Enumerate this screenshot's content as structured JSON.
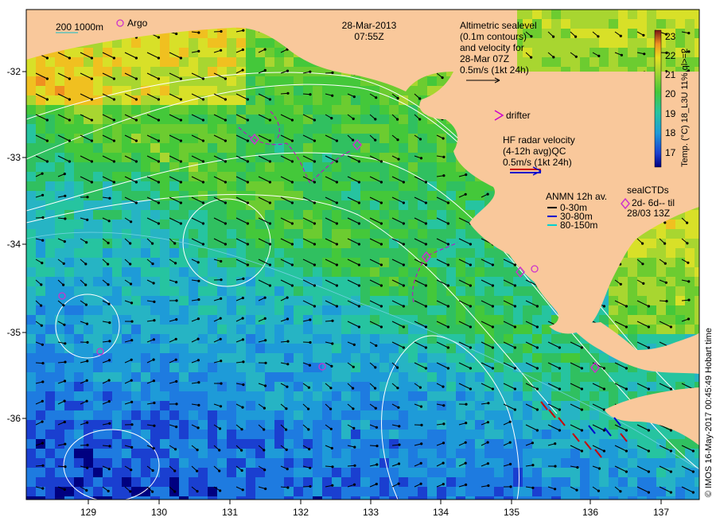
{
  "datetime": {
    "date": "28-Mar-2013",
    "time": "07:55Z"
  },
  "scale_legend": {
    "depth_contours": "200  1000m",
    "argo": "Argo"
  },
  "altimetry": {
    "lines": [
      "Altimetric sealevel",
      "(0.1m contours)",
      "and velocity for",
      "28-Mar 07Z",
      "0.5m/s (1kt 24h)"
    ]
  },
  "drifter": {
    "label": "drifter"
  },
  "hf_radar": {
    "lines": [
      "HF radar velocity",
      "(4-12h avg)QC",
      "0.5m/s (1kt 24h)"
    ]
  },
  "anmn": {
    "title": "ANMN 12h av.",
    "items": [
      {
        "label": "0-30m",
        "color": "#000000"
      },
      {
        "label": "30-80m",
        "color": "#0000cc"
      },
      {
        "label": "80-150m",
        "color": "#00d0d0"
      }
    ]
  },
  "seal": {
    "lines": [
      "sealCTDs",
      "2d- 6d-- til",
      "28/03 13Z"
    ]
  },
  "colorbar": {
    "title": "Temp. (°C) 18_L3U 11% ql>=2",
    "ticks": [
      "23",
      "22",
      "21",
      "20",
      "19",
      "18",
      "17"
    ],
    "range": [
      16.5,
      23.4
    ]
  },
  "credit": "© IMOS 16-May-2017 00:45:49 Hobart time",
  "axes": {
    "x_ticks": [
      "129",
      "130",
      "131",
      "132",
      "133",
      "134",
      "135",
      "136",
      "137"
    ],
    "y_ticks": [
      "-32",
      "-33",
      "-34",
      "-35",
      "-36"
    ]
  },
  "colors": {
    "land": "#f9c89b",
    "argo": "#cc33cc",
    "drifter": "#cc00cc",
    "contour": "#ffffff",
    "radar_red": "#cc0000",
    "radar_blue": "#0000cc"
  },
  "markers": {
    "argo_count": 4,
    "seal_count": 5
  }
}
